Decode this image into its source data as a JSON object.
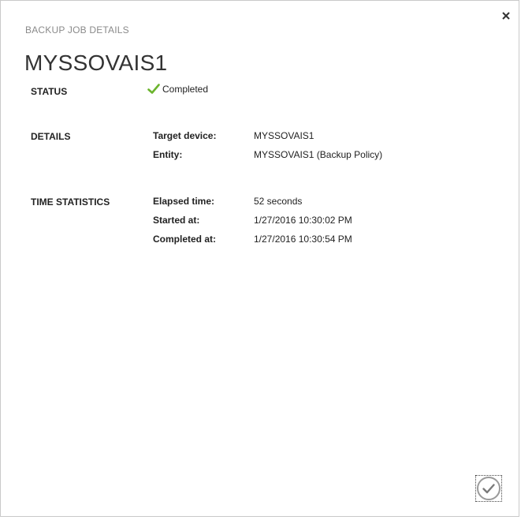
{
  "header": {
    "subtitle": "BACKUP JOB DETAILS",
    "title": "MYSSOVAIS1"
  },
  "status": {
    "label": "STATUS",
    "value": "Completed",
    "icon": "checkmark-icon",
    "color": "#6bb42d"
  },
  "details": {
    "label": "DETAILS",
    "fields": [
      {
        "label": "Target device:",
        "value": "MYSSOVAIS1"
      },
      {
        "label": "Entity:",
        "value": "MYSSOVAIS1 (Backup Policy)"
      }
    ]
  },
  "time_statistics": {
    "label": "TIME STATISTICS",
    "fields": [
      {
        "label": "Elapsed time:",
        "value": "52 seconds"
      },
      {
        "label": "Started at:",
        "value": "1/27/2016 10:30:02 PM"
      },
      {
        "label": "Completed at:",
        "value": "1/27/2016 10:30:54 PM"
      }
    ]
  },
  "controls": {
    "close_icon": "close-icon",
    "ok_icon": "checkmark-circle-icon"
  }
}
